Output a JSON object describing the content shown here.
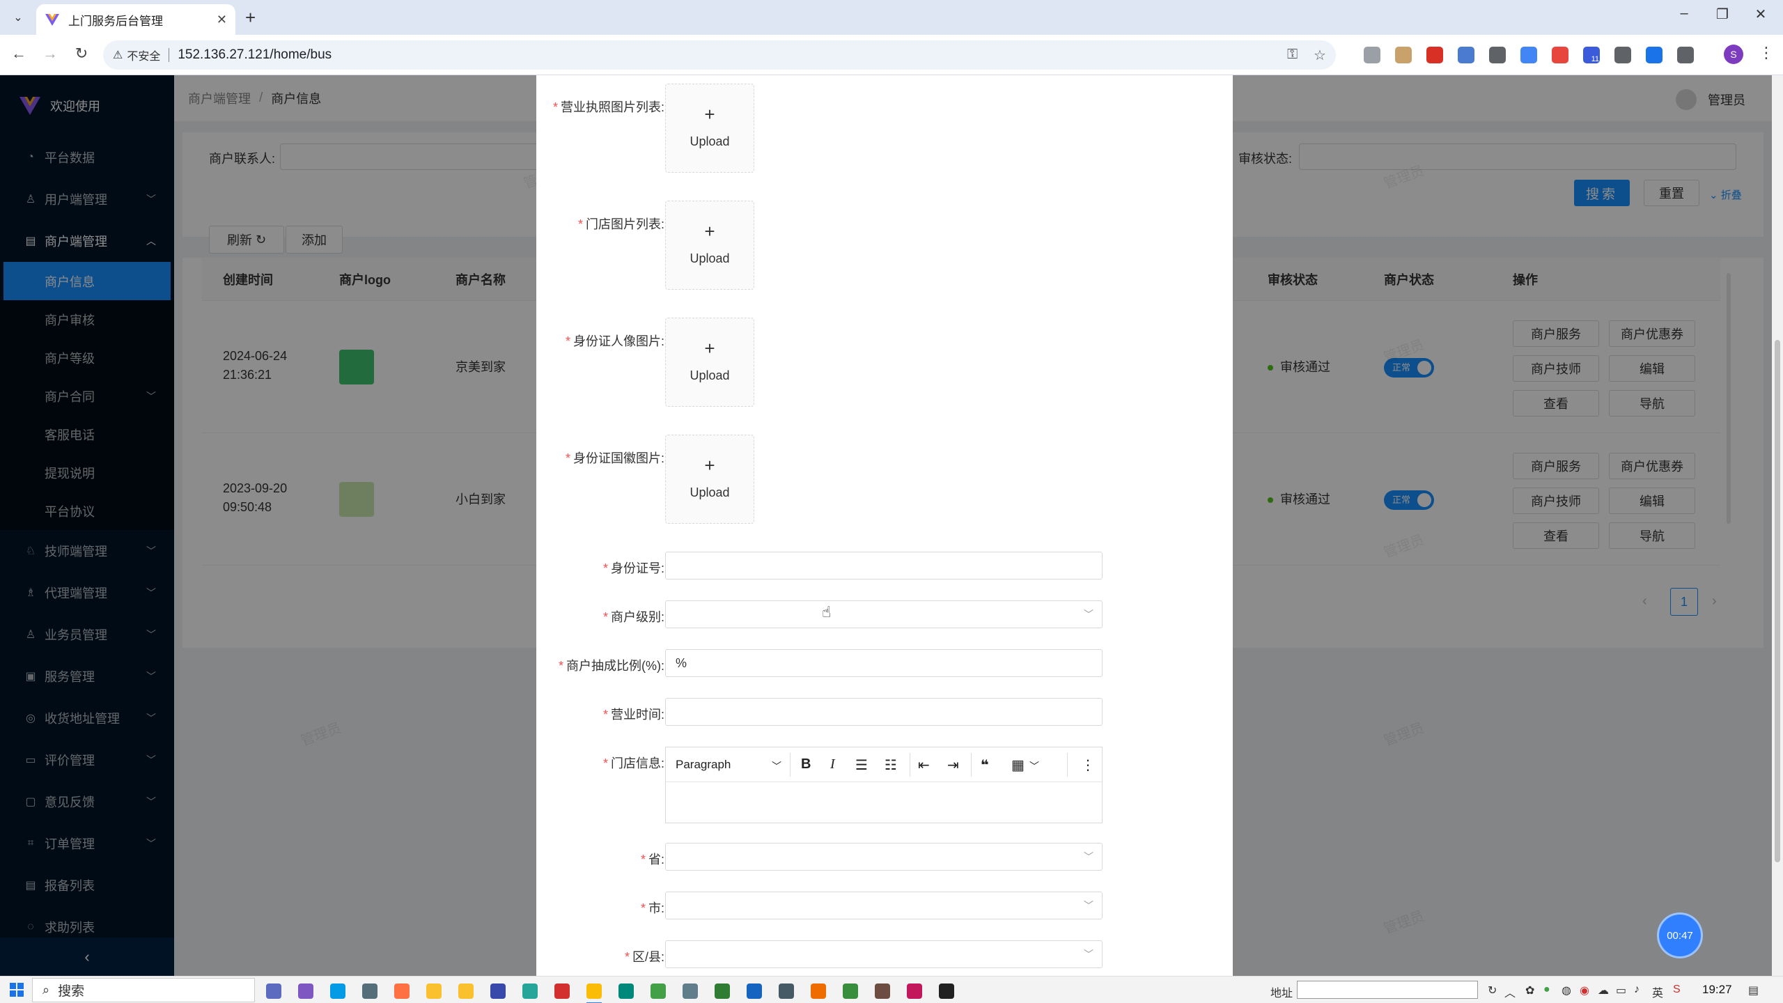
{
  "browser": {
    "tab_title": "上门服务后台管理",
    "insecure_label": "不安全",
    "url": "152.136.27.121/home/bus",
    "profile_initial": "S",
    "ext_badge": "11"
  },
  "sidebar": {
    "brand": "欢迎使用",
    "items": [
      {
        "label": "平台数据",
        "icon": "dashboard-icon"
      },
      {
        "label": "用户端管理",
        "icon": "user-icon"
      },
      {
        "label": "商户端管理",
        "icon": "shop-icon"
      },
      {
        "label": "技师端管理",
        "icon": "tech-icon"
      },
      {
        "label": "代理端管理",
        "icon": "agent-icon"
      },
      {
        "label": "业务员管理",
        "icon": "user-icon"
      },
      {
        "label": "服务管理",
        "icon": "service-icon"
      },
      {
        "label": "收货地址管理",
        "icon": "location-icon"
      },
      {
        "label": "评价管理",
        "icon": "comment-icon"
      },
      {
        "label": "意见反馈",
        "icon": "feedback-icon"
      },
      {
        "label": "订单管理",
        "icon": "order-icon"
      },
      {
        "label": "报备列表",
        "icon": "list-icon"
      },
      {
        "label": "求助列表",
        "icon": "help-icon"
      }
    ],
    "subitems": [
      "商户信息",
      "商户审核",
      "商户等级",
      "商户合同",
      "客服电话",
      "提现说明",
      "平台协议"
    ]
  },
  "header": {
    "breadcrumb": [
      "商户端管理",
      "商户信息"
    ],
    "user": "管理员"
  },
  "search": {
    "contact_label": "商户联系人:",
    "audit_label": "审核状态:",
    "search_button": "搜索",
    "reset_button": "重置",
    "fold_link": "折叠"
  },
  "toolbar": {
    "refresh": "刷新",
    "add": "添加"
  },
  "table": {
    "columns": [
      "创建时间",
      "商户logo",
      "商户名称",
      "审核状态",
      "商户状态",
      "操作"
    ],
    "rows": [
      {
        "date": "2024-06-24",
        "time": "21:36:21",
        "name": "京美到家",
        "audit": "审核通过",
        "status": "正常"
      },
      {
        "date": "2023-09-20",
        "time": "09:50:48",
        "name": "小白到家",
        "audit": "审核通过",
        "status": "正常"
      }
    ],
    "actions": [
      "商户服务",
      "商户优惠券",
      "商户技师",
      "编辑",
      "查看",
      "导航"
    ],
    "page": "1"
  },
  "watermark": "管理员",
  "form": {
    "business_license": "营业执照图片列表:",
    "store_images": "门店图片列表:",
    "id_front": "身份证人像图片:",
    "id_back": "身份证国徽图片:",
    "upload_text": "Upload",
    "id_number": "身份证号:",
    "level": "商户级别:",
    "commission": "商户抽成比例(%):",
    "commission_value": "%",
    "hours": "营业时间:",
    "store_info": "门店信息:",
    "editor_paragraph": "Paragraph",
    "province": "省:",
    "city": "市:",
    "district": "区/县:"
  },
  "timer": "00:47",
  "taskbar": {
    "search": "搜索",
    "addr_label": "地址",
    "ime": "英",
    "time": "19:27"
  }
}
